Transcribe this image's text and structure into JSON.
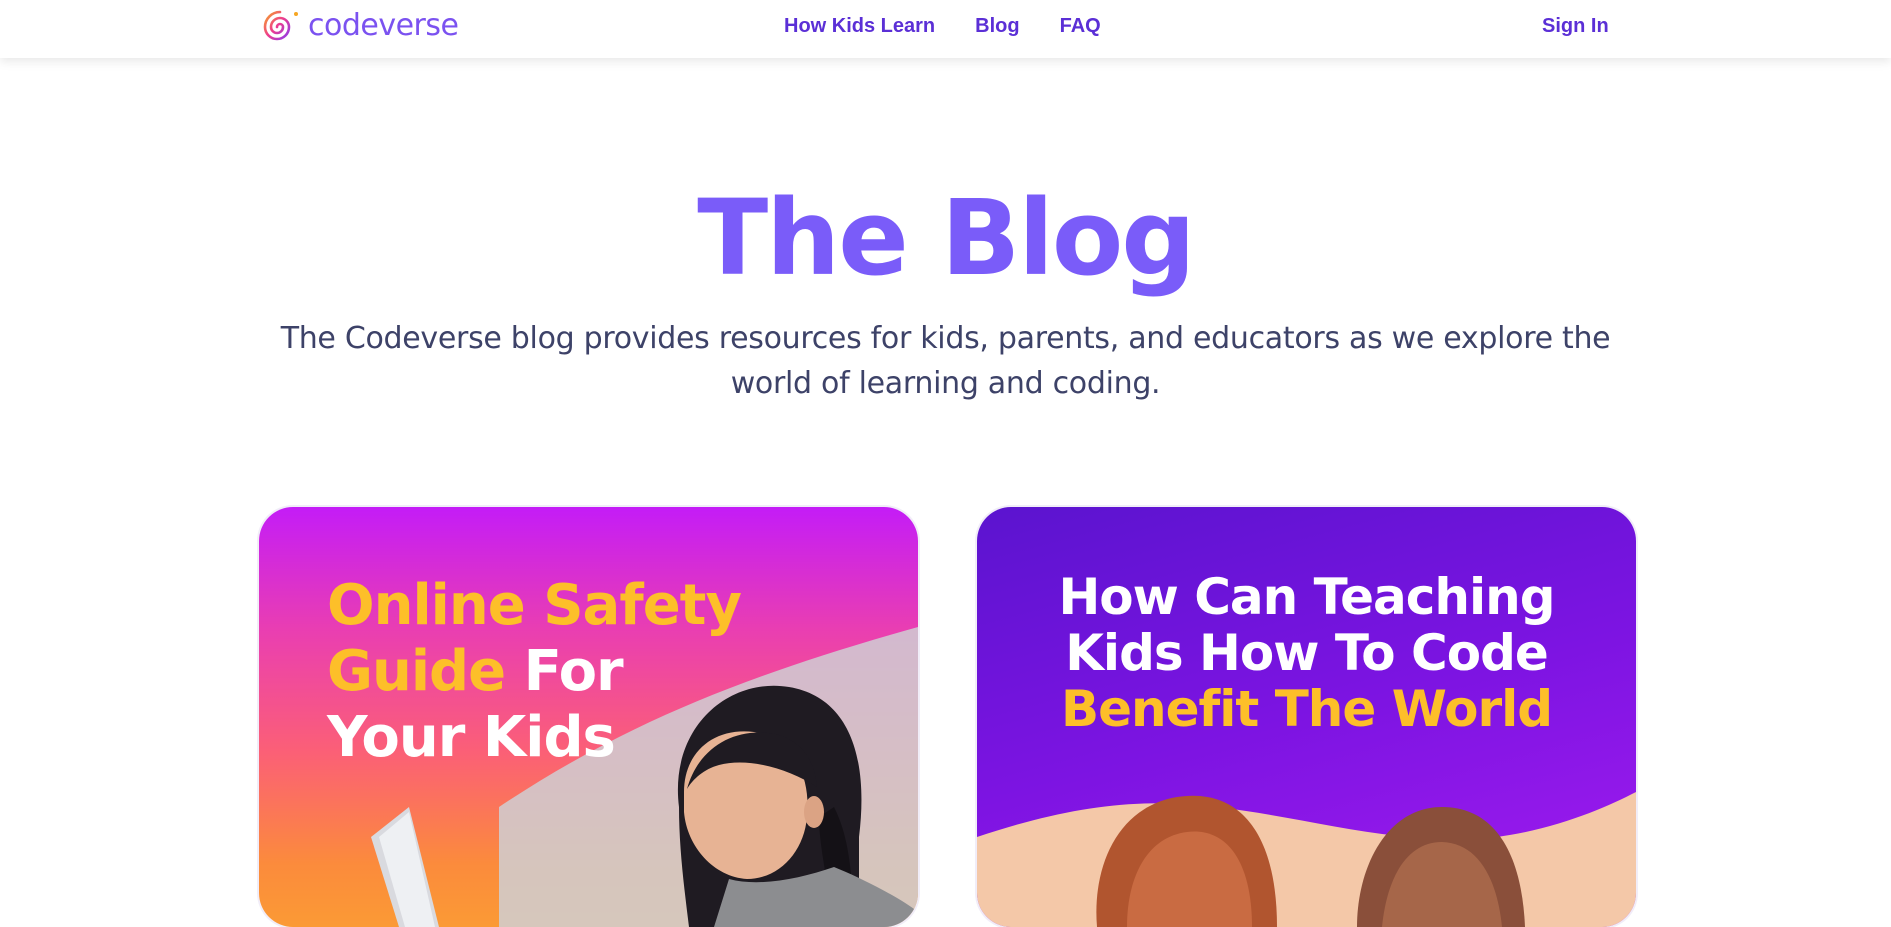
{
  "header": {
    "logo_text": "codeverse",
    "nav": [
      {
        "label": "How Kids Learn"
      },
      {
        "label": "Blog"
      },
      {
        "label": "FAQ"
      }
    ],
    "sign_in": "Sign In"
  },
  "hero": {
    "title": "The Blog",
    "subtitle": "The Codeverse blog provides resources for kids, parents, and educators as we explore the world of learning and coding."
  },
  "cards": [
    {
      "title_lines": [
        {
          "highlight": "Online Safety",
          "rest": ""
        },
        {
          "highlight": "Guide",
          "rest": " For"
        },
        {
          "highlight": "",
          "rest": "Your Kids"
        }
      ],
      "image": "girl-with-laptop-photo"
    },
    {
      "title_lines": [
        {
          "highlight": "",
          "rest": "How Can Teaching"
        },
        {
          "highlight": "",
          "rest": "Kids How To Code"
        },
        {
          "highlight": "Benefit The World",
          "rest": ""
        }
      ],
      "image": "two-kids-photo"
    }
  ],
  "colors": {
    "brand_purple": "#7a5cf9",
    "nav_purple": "#5b2fd6",
    "highlight_yellow": "#fdbf29",
    "body_text": "#3d4268"
  }
}
